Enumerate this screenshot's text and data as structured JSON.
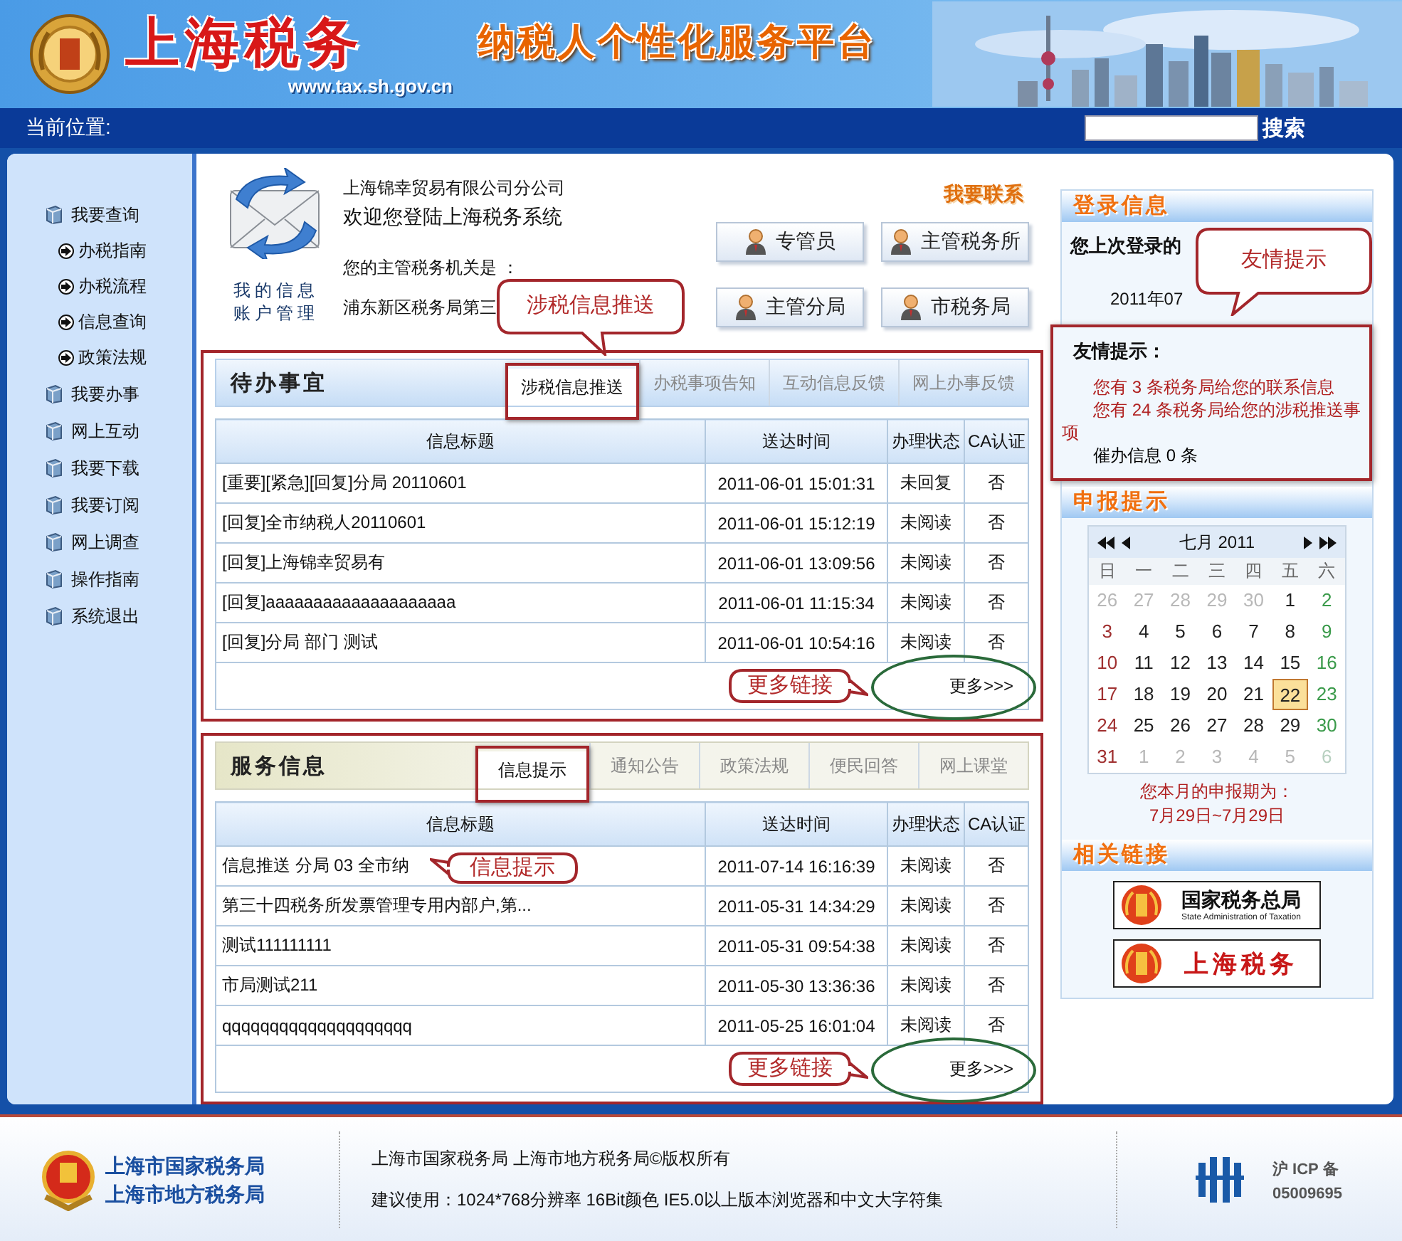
{
  "header": {
    "brand": "上海税务",
    "url": "www.tax.sh.gov.cn",
    "slogan": "纳税人个性化服务平台"
  },
  "navbar": {
    "location_label": "当前位置:",
    "search_button": "搜索"
  },
  "sidebar": {
    "items": [
      {
        "label": "我要查询",
        "children": [
          {
            "label": "办税指南"
          },
          {
            "label": "办税流程"
          },
          {
            "label": "信息查询"
          },
          {
            "label": "政策法规"
          }
        ]
      },
      {
        "label": "我要办事"
      },
      {
        "label": "网上互动"
      },
      {
        "label": "我要下载"
      },
      {
        "label": "我要订阅"
      },
      {
        "label": "网上调查"
      },
      {
        "label": "操作指南"
      },
      {
        "label": "系统退出"
      }
    ]
  },
  "account": {
    "caption": "我的信息账户管理",
    "company": "上海锦幸贸易有限公司分公司",
    "welcome": "欢迎您登陆上海税务系统",
    "authority_label": "您的主管税务机关是 ：",
    "authority": "浦东新区税务局第三",
    "callout": "涉税信息推送"
  },
  "contact": {
    "title": "我要联系",
    "buttons": [
      "专管员",
      "主管税务所",
      "主管分局",
      "市税务局"
    ]
  },
  "panels": [
    {
      "title": "待办事宜",
      "tabs": [
        {
          "label": "涉税信息推送",
          "selected": true
        },
        {
          "label": "办税事项告知",
          "selected": false
        },
        {
          "label": "互动信息反馈",
          "selected": false
        },
        {
          "label": "网上办事反馈",
          "selected": false
        }
      ],
      "columns": [
        "信息标题",
        "送达时间",
        "办理状态",
        "CA认证"
      ],
      "rows": [
        [
          "[重要][紧急][回复]分局 20110601",
          "2011-06-01 15:01:31",
          "未回复",
          "否"
        ],
        [
          "[回复]全市纳税人20110601",
          "2011-06-01 15:12:19",
          "未阅读",
          "否"
        ],
        [
          "[回复]上海锦幸贸易有",
          "2011-06-01 13:09:56",
          "未阅读",
          "否"
        ],
        [
          "[回复]aaaaaaaaaaaaaaaaaaaa",
          "2011-06-01 11:15:34",
          "未阅读",
          "否"
        ],
        [
          "[回复]分局 部门 测试",
          "2011-06-01 10:54:16",
          "未阅读",
          "否"
        ]
      ],
      "more": "更多>>>",
      "more_callout": "更多链接"
    },
    {
      "title": "服务信息",
      "tabs": [
        {
          "label": "信息提示",
          "selected": true
        },
        {
          "label": "通知公告",
          "selected": false
        },
        {
          "label": "政策法规",
          "selected": false
        },
        {
          "label": "便民回答",
          "selected": false
        },
        {
          "label": "网上课堂",
          "selected": false
        }
      ],
      "columns": [
        "信息标题",
        "送达时间",
        "办理状态",
        "CA认证"
      ],
      "rows": [
        [
          "信息推送 分局 03 全市纳",
          "2011-07-14 16:16:39",
          "未阅读",
          "否"
        ],
        [
          "第三十四税务所发票管理专用内部户,第...",
          "2011-05-31 14:34:29",
          "未阅读",
          "否"
        ],
        [
          "测试111111111",
          "2011-05-31 09:54:38",
          "未阅读",
          "否"
        ],
        [
          "市局测试211",
          "2011-05-30 13:36:36",
          "未阅读",
          "否"
        ],
        [
          "qqqqqqqqqqqqqqqqqqqq",
          "2011-05-25 16:01:04",
          "未阅读",
          "否"
        ]
      ],
      "more": "更多>>>",
      "more_callout": "更多链接",
      "tab_callout": "信息提示"
    }
  ],
  "login": {
    "title": "登录信息",
    "last_login_label": "您上次登录的",
    "last_login_time": "2011年07",
    "callout": "友情提示"
  },
  "tips": {
    "title": "友情提示：",
    "lines": [
      {
        "text": "您有 3 条税务局给您的联系信息",
        "color": "#b02020"
      },
      {
        "text": "您有 24 条税务局给您的涉税推送事项",
        "color": "#b02020"
      },
      {
        "text": "催办信息 0 条",
        "color": "#000000"
      }
    ]
  },
  "filing": {
    "title": "申报提示",
    "calendar": {
      "month": "七月 2011",
      "weekdays": [
        "日",
        "一",
        "二",
        "三",
        "四",
        "五",
        "六"
      ],
      "weeks": [
        [
          {
            "day": "26",
            "muted": true,
            "selected": false
          },
          {
            "day": "27",
            "muted": true,
            "selected": false
          },
          {
            "day": "28",
            "muted": true,
            "selected": false
          },
          {
            "day": "29",
            "muted": true,
            "selected": false
          },
          {
            "day": "30",
            "muted": true,
            "selected": false
          },
          {
            "day": "1",
            "muted": false,
            "selected": false
          },
          {
            "day": "2",
            "muted": false,
            "selected": false
          }
        ],
        [
          {
            "day": "3",
            "muted": false,
            "selected": false
          },
          {
            "day": "4",
            "muted": false,
            "selected": false
          },
          {
            "day": "5",
            "muted": false,
            "selected": false
          },
          {
            "day": "6",
            "muted": false,
            "selected": false
          },
          {
            "day": "7",
            "muted": false,
            "selected": false
          },
          {
            "day": "8",
            "muted": false,
            "selected": false
          },
          {
            "day": "9",
            "muted": false,
            "selected": false
          }
        ],
        [
          {
            "day": "10",
            "muted": false,
            "selected": false
          },
          {
            "day": "11",
            "muted": false,
            "selected": false
          },
          {
            "day": "12",
            "muted": false,
            "selected": false
          },
          {
            "day": "13",
            "muted": false,
            "selected": false
          },
          {
            "day": "14",
            "muted": false,
            "selected": false
          },
          {
            "day": "15",
            "muted": false,
            "selected": false
          },
          {
            "day": "16",
            "muted": false,
            "selected": false
          }
        ],
        [
          {
            "day": "17",
            "muted": false,
            "selected": false
          },
          {
            "day": "18",
            "muted": false,
            "selected": false
          },
          {
            "day": "19",
            "muted": false,
            "selected": false
          },
          {
            "day": "20",
            "muted": false,
            "selected": false
          },
          {
            "day": "21",
            "muted": false,
            "selected": false
          },
          {
            "day": "22",
            "muted": false,
            "selected": true
          },
          {
            "day": "23",
            "muted": false,
            "selected": false
          }
        ],
        [
          {
            "day": "24",
            "muted": false,
            "selected": false
          },
          {
            "day": "25",
            "muted": false,
            "selected": false
          },
          {
            "day": "26",
            "muted": false,
            "selected": false
          },
          {
            "day": "27",
            "muted": false,
            "selected": false
          },
          {
            "day": "28",
            "muted": false,
            "selected": false
          },
          {
            "day": "29",
            "muted": false,
            "selected": false
          },
          {
            "day": "30",
            "muted": false,
            "selected": false
          }
        ],
        [
          {
            "day": "31",
            "muted": false,
            "selected": false
          },
          {
            "day": "1",
            "muted": true,
            "selected": false
          },
          {
            "day": "2",
            "muted": true,
            "selected": false
          },
          {
            "day": "3",
            "muted": true,
            "selected": false
          },
          {
            "day": "4",
            "muted": true,
            "selected": false
          },
          {
            "day": "5",
            "muted": true,
            "selected": false
          },
          {
            "day": "6",
            "muted": true,
            "selected": false
          }
        ]
      ]
    },
    "period_label": "您本月的申报期为：",
    "period": "7月29日~7月29日"
  },
  "links": {
    "title": "相关链接",
    "items": [
      {
        "name": "国家税务总局",
        "subtitle": "State Administration of Taxation"
      },
      {
        "name": "上海税务"
      }
    ]
  },
  "footer": {
    "org_lines": [
      "上海市国家税务局",
      "上海市地方税务局"
    ],
    "copyright": "上海市国家税务局 上海市地方税务局©版权所有",
    "recommendation": "建议使用：1024*768分辨率 16Bit颜色 IE5.0以上版本浏览器和中文大字符集",
    "icp_lines": [
      "沪 ICP 备",
      "05009695"
    ]
  }
}
